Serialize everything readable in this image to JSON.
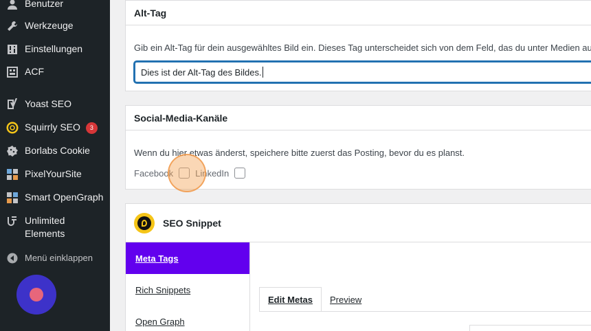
{
  "sidebar": {
    "items": [
      {
        "label": "Benutzer",
        "icon": "user-icon"
      },
      {
        "label": "Werkzeuge",
        "icon": "wrench-icon"
      },
      {
        "label": "Einstellungen",
        "icon": "settings-sliders-icon"
      },
      {
        "label": "ACF",
        "icon": "acf-grid-icon"
      },
      {
        "label": "Yoast SEO",
        "icon": "yoast-icon"
      },
      {
        "label": "Squirrly SEO",
        "icon": "squirrly-icon",
        "badge": "3"
      },
      {
        "label": "Borlabs Cookie",
        "icon": "cookie-icon"
      },
      {
        "label": "PixelYourSite",
        "icon": "pixelyoursite-icon"
      },
      {
        "label": "Smart OpenGraph",
        "icon": "opengraph-icon"
      },
      {
        "label": "Unlimited Elements",
        "icon": "unlimited-elements-icon"
      }
    ],
    "collapse_label": "Menü einklappen"
  },
  "alt_tag": {
    "title": "Alt-Tag",
    "description": "Gib ein Alt-Tag für dein ausgewähltes Bild ein. Dieses Tag unterscheidet sich von dem Feld, das du unter Medien aus",
    "value": "Dies ist der Alt-Tag des Bildes."
  },
  "social": {
    "title": "Social-Media-Kanäle",
    "description": "Wenn du hier etwas änderst, speichere bitte zuerst das Posting, bevor du es planst.",
    "facebook_label": "Facebook",
    "linkedin_label": "LinkedIn"
  },
  "seo_snippet": {
    "title": "SEO Snippet",
    "nav": [
      "Meta Tags",
      "Rich Snippets",
      "Open Graph"
    ],
    "tabs": [
      "Edit Metas",
      "Preview"
    ]
  },
  "colors": {
    "sidebar_bg": "#1d2327",
    "accent_purple": "#6200ee",
    "badge_red": "#d63638",
    "focus_blue": "#2271b1"
  }
}
